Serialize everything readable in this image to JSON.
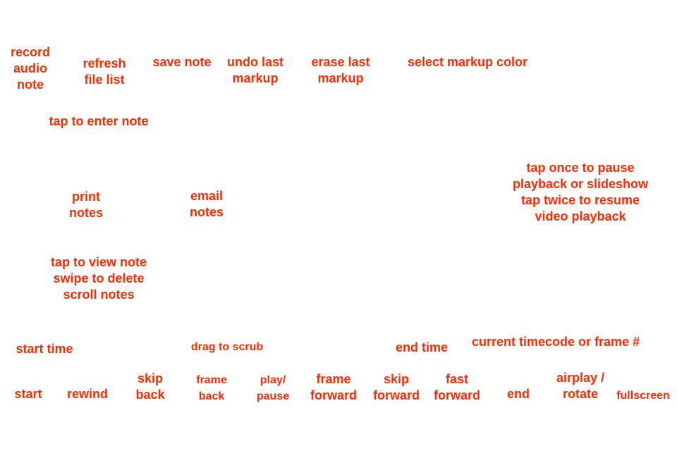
{
  "style": {
    "label_color": "#ff2a00",
    "background": "#ffffff"
  },
  "labels": {
    "record_audio_note": "record\naudio\nnote",
    "refresh_file_list": "refresh\nfile list",
    "save_note": "save note",
    "undo_last_markup": "undo last\nmarkup",
    "erase_last_markup": "erase last\nmarkup",
    "select_markup_color": "select markup color",
    "tap_to_enter_note": "tap to enter note",
    "pause_resume_help": "tap once to pause\nplayback or slideshow\ntap twice to resume\nvideo playback",
    "print_notes": "print\nnotes",
    "email_notes": "email\nnotes",
    "note_list_help": "tap to view note\nswipe to delete\nscroll notes",
    "start_time": "start time",
    "drag_to_scrub": "drag to scrub",
    "end_time": "end time",
    "current_timecode": "current timecode or frame #",
    "start": "start",
    "rewind": "rewind",
    "skip_back": "skip\nback",
    "frame_back": "frame\nback",
    "play_pause": "play/\npause",
    "frame_forward": "frame\nforward",
    "skip_forward": "skip\nforward",
    "fast_forward": "fast\nforward",
    "end": "end",
    "airplay_rotate": "airplay /\nrotate",
    "fullscreen": "fullscreen"
  }
}
